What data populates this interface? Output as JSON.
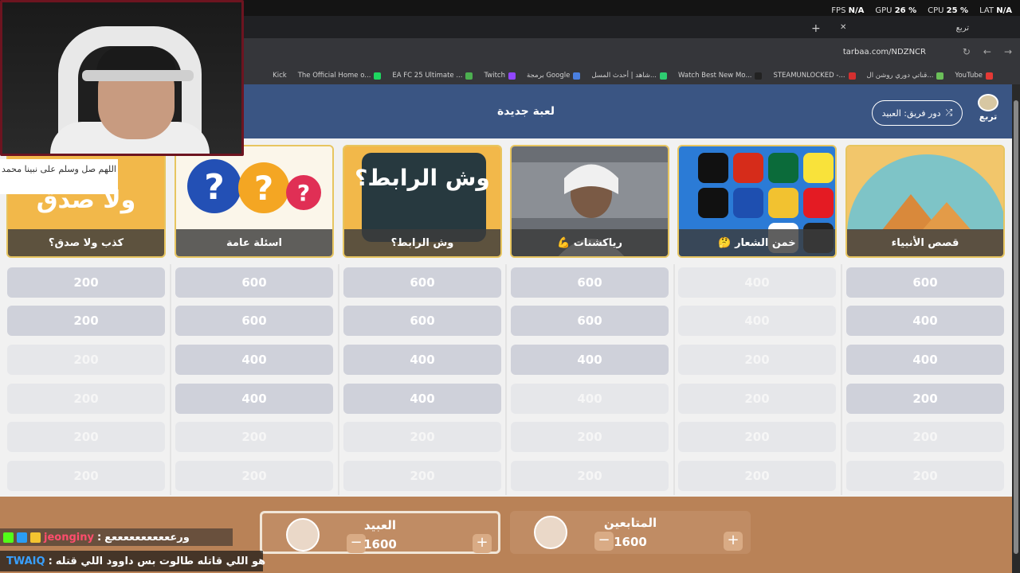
{
  "perf": {
    "fps_label": "FPS",
    "fps": "N/A",
    "gpu_label": "GPU",
    "gpu": "26 %",
    "cpu_label": "CPU",
    "cpu": "25 %",
    "lat_label": "LAT",
    "lat": "N/A"
  },
  "browser": {
    "tab_title": "تربع",
    "url": "tarbaa.com/NDZNCR",
    "bookmarks": [
      "YouTube",
      "قناتي دوري روشن ال...",
      "STEAMUNLOCKED -...",
      "Watch Best New Mo...",
      "شاهد | أحدث المسل...",
      "برمجة Google",
      "Twitch",
      "EA FC 25 Ultimate ...",
      "The Official Home o...",
      "Kick"
    ]
  },
  "webcam_note": "اللهم صل وسلم على نبينا محمد",
  "header": {
    "title": "لعبة جديدة",
    "team_turn": "دور فريق: العبيد",
    "logo_text": "تربع"
  },
  "categories": [
    {
      "label": "قصص الأنبياء",
      "art": "desert-pyramids"
    },
    {
      "label": "🤔 خمن الشعار",
      "art": "brand-logos"
    },
    {
      "label": "💪 رياكشنات",
      "art": "man-portrait"
    },
    {
      "label": "وش الرابط؟",
      "art": "text-tile",
      "art_text": "وش الرابط؟"
    },
    {
      "label": "اسئلة عامة",
      "art": "question-bubbles"
    },
    {
      "label": "كذب ولا صدق؟",
      "art": "text-tile",
      "art_text": "ولا صدق"
    }
  ],
  "grid": [
    [
      {
        "v": "600",
        "on": true
      },
      {
        "v": "400",
        "on": true
      },
      {
        "v": "400",
        "on": true
      },
      {
        "v": "200",
        "on": true
      },
      {
        "v": "200",
        "on": false
      },
      {
        "v": "200",
        "on": false
      }
    ],
    [
      {
        "v": "400",
        "on": false
      },
      {
        "v": "400",
        "on": false
      },
      {
        "v": "200",
        "on": false
      },
      {
        "v": "200",
        "on": false
      },
      {
        "v": "200",
        "on": false
      },
      {
        "v": "200",
        "on": false
      }
    ],
    [
      {
        "v": "600",
        "on": true
      },
      {
        "v": "600",
        "on": true
      },
      {
        "v": "400",
        "on": true
      },
      {
        "v": "400",
        "on": false
      },
      {
        "v": "200",
        "on": false
      },
      {
        "v": "200",
        "on": false
      }
    ],
    [
      {
        "v": "600",
        "on": true
      },
      {
        "v": "600",
        "on": true
      },
      {
        "v": "400",
        "on": true
      },
      {
        "v": "400",
        "on": true
      },
      {
        "v": "200",
        "on": false
      },
      {
        "v": "200",
        "on": false
      }
    ],
    [
      {
        "v": "600",
        "on": true
      },
      {
        "v": "600",
        "on": true
      },
      {
        "v": "400",
        "on": true
      },
      {
        "v": "400",
        "on": true
      },
      {
        "v": "200",
        "on": false
      },
      {
        "v": "200",
        "on": false
      }
    ],
    [
      {
        "v": "200",
        "on": true
      },
      {
        "v": "200",
        "on": true
      },
      {
        "v": "200",
        "on": false
      },
      {
        "v": "200",
        "on": false
      },
      {
        "v": "200",
        "on": false
      },
      {
        "v": "200",
        "on": false
      }
    ]
  ],
  "teams": [
    {
      "name": "المتابعين",
      "score": "1600"
    },
    {
      "name": "العبيد",
      "score": "1600"
    }
  ],
  "chat": [
    {
      "user": "jeonginy",
      "message": "ورعععععععععععع"
    },
    {
      "user": "TWAIQ",
      "message": "هو اللي قاتله طالوت بس داوود اللي قتله"
    }
  ]
}
